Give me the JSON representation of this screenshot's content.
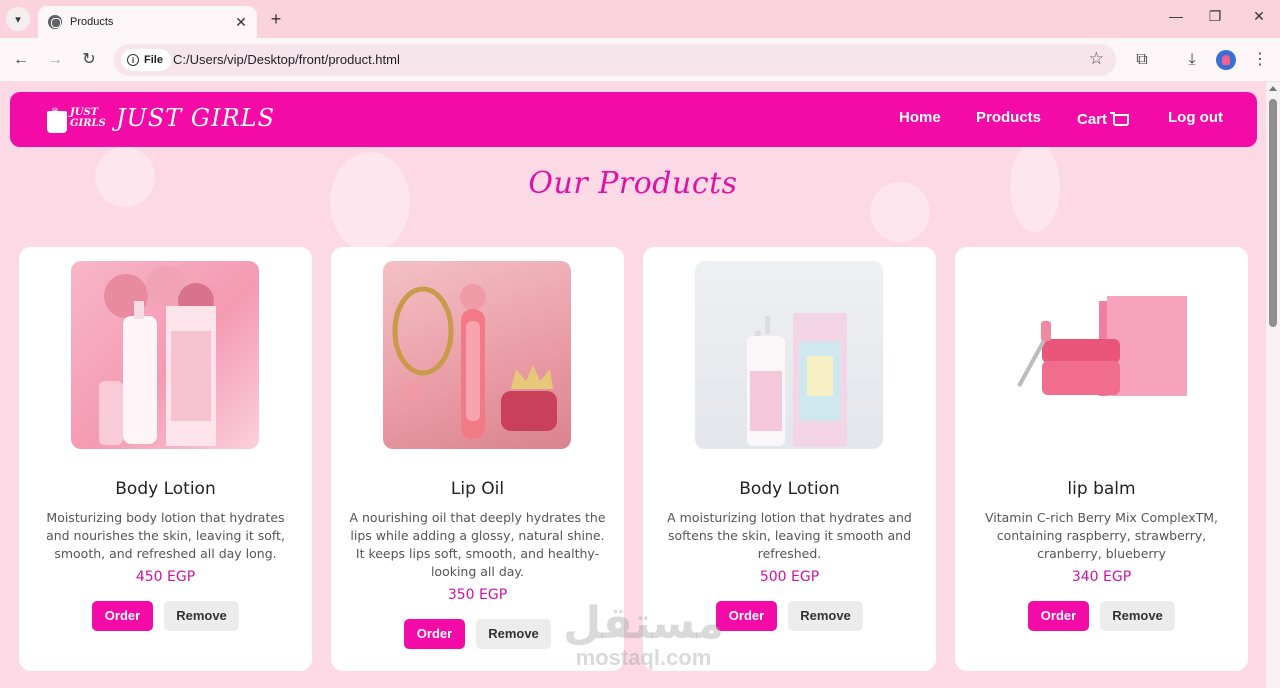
{
  "browser": {
    "tab_title": "Products",
    "tab_close": "✕",
    "new_tab": "+",
    "site_chip": "File",
    "url": "C:/Users/vip/Desktop/front/product.html"
  },
  "navbar": {
    "logo_small_line1": "JUST",
    "logo_small_line2": "GIRLS",
    "brand": "JUST GIRLS",
    "links": [
      "Home",
      "Products",
      "Cart",
      "Log out"
    ]
  },
  "page_title": "Our Products",
  "products": [
    {
      "name": "Body Lotion",
      "description": "Moisturizing body lotion that hydrates and nourishes the skin, leaving it soft, smooth, and refreshed all day long.",
      "price": "450 EGP",
      "order_label": "Order",
      "remove_label": "Remove"
    },
    {
      "name": "Lip Oil",
      "description": "A nourishing oil that deeply hydrates the lips while adding a glossy, natural shine. It keeps lips soft, smooth, and healthy-looking all day.",
      "price": "350 EGP",
      "order_label": "Order",
      "remove_label": "Remove"
    },
    {
      "name": "Body Lotion",
      "description": "A moisturizing lotion that hydrates and softens the skin, leaving it smooth and refreshed.",
      "price": "500 EGP",
      "order_label": "Order",
      "remove_label": "Remove"
    },
    {
      "name": "lip balm",
      "description": "Vitamin C-rich Berry Mix ComplexTM, containing raspberry, strawberry, cranberry, blueberry",
      "price": "340 EGP",
      "order_label": "Order",
      "remove_label": "Remove"
    }
  ],
  "watermark": {
    "arabic": "مستقل",
    "latin": "mostaql.com"
  },
  "colors": {
    "brand_pink": "#f40aa6",
    "page_bg": "#fcd9e4",
    "price": "#d010a0"
  }
}
